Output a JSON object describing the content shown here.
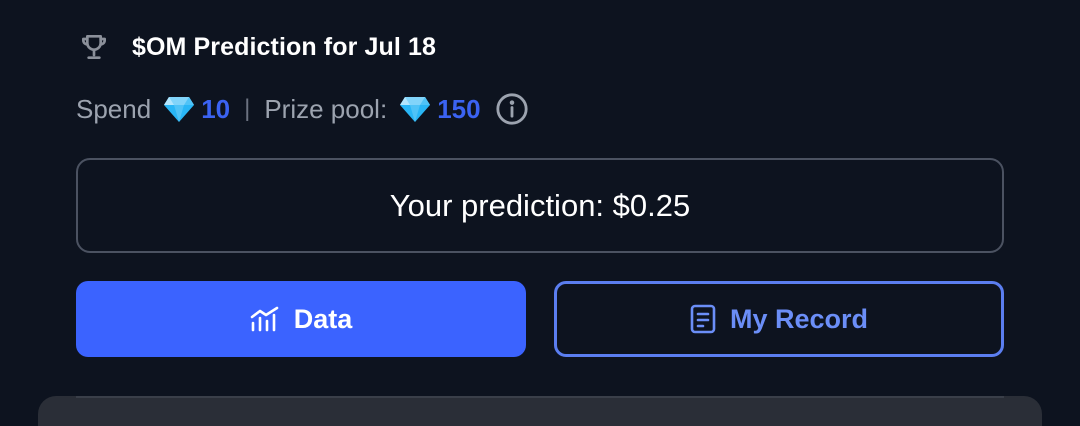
{
  "header": {
    "title": "$OM Prediction for Jul 18",
    "icon": "trophy-icon"
  },
  "meta": {
    "spend_label": "Spend",
    "spend_value": "10",
    "separator": "|",
    "prize_label": "Prize pool:",
    "prize_value": "150",
    "gem_icon": "gem-icon",
    "info_icon": "info-icon"
  },
  "prediction": {
    "text": "Your prediction: $0.25"
  },
  "buttons": {
    "data_label": "Data",
    "record_label": "My Record"
  },
  "colors": {
    "background": "#0d131f",
    "accent": "#3b63ff",
    "value_blue": "#3b63f2",
    "muted_text": "#9ca3af"
  }
}
